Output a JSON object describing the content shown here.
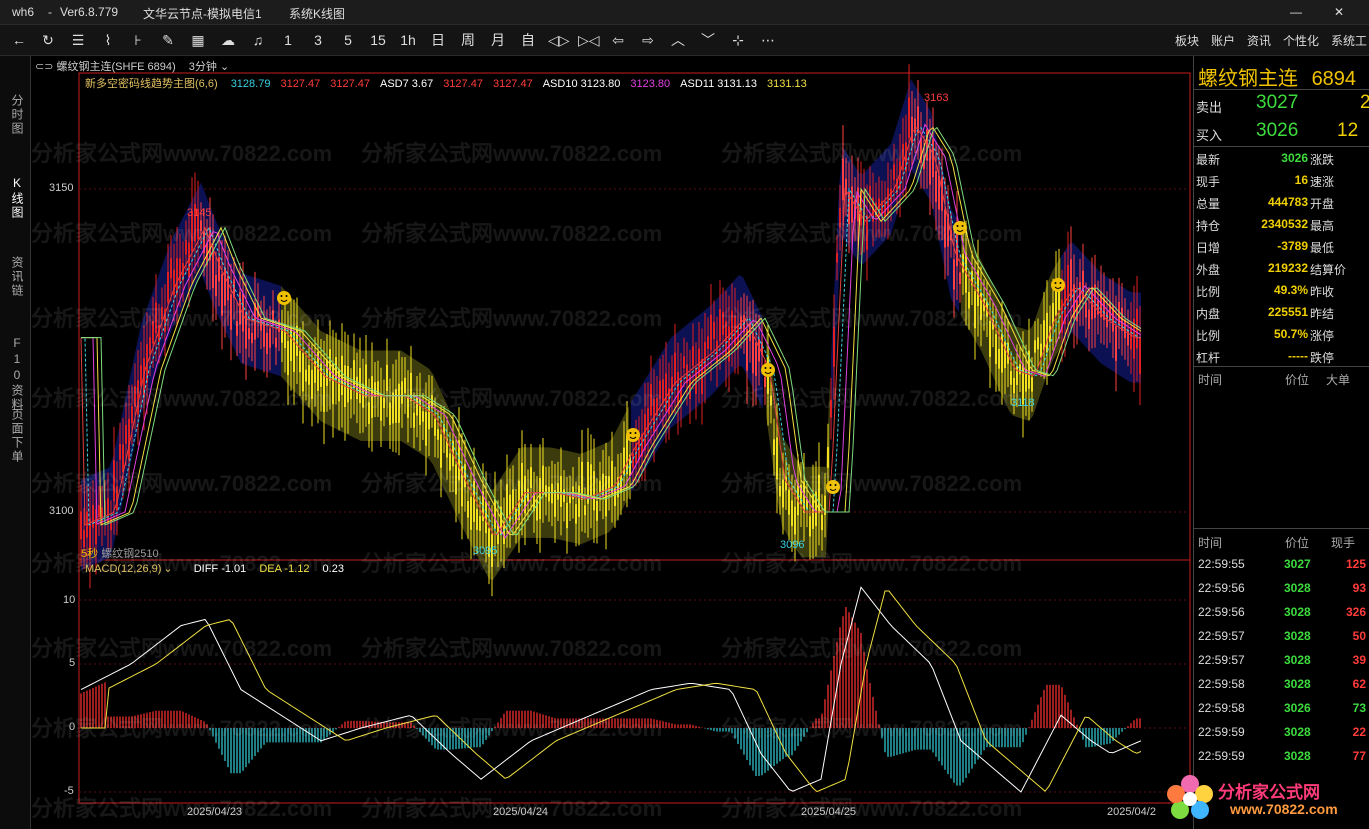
{
  "titlebar": {
    "app": "wh6",
    "sep": "-",
    "version": "Ver6.8.779",
    "server": "文华云节点-模拟电信1",
    "view": "系统K线图"
  },
  "toolbar": {
    "periods": [
      "1",
      "3",
      "5",
      "15",
      "1h",
      "日",
      "周",
      "月",
      "自"
    ],
    "menu": [
      "板块",
      "账户",
      "资讯",
      "个性化",
      "系统工"
    ]
  },
  "leftnav": {
    "tabs": [
      "分时图",
      "K线图",
      "资讯链",
      "F10资料",
      "页面下单"
    ]
  },
  "chart": {
    "contract": "螺纹钢主连(SHFE 6894)",
    "period": "3分钟",
    "indicator_main": "新多空密码线趋势主图(6,6)",
    "legend_values": [
      {
        "text": "3128.79",
        "color": "#39d0e0"
      },
      {
        "text": "3127.47",
        "color": "#ff3b3b"
      },
      {
        "text": "3127.47",
        "color": "#ff3b3b"
      },
      {
        "text": "ASD7 3.67",
        "color": "#ffffff"
      },
      {
        "text": "3127.47",
        "color": "#ff3b3b"
      },
      {
        "text": "3127.47",
        "color": "#ff3b3b"
      },
      {
        "text": "ASD10 3123.80",
        "color": "#ffffff"
      },
      {
        "text": "3123.80",
        "color": "#e040e0"
      },
      {
        "text": "ASD11 3131.13",
        "color": "#ffffff"
      },
      {
        "text": "3131.13",
        "color": "#f0e040"
      }
    ],
    "y_labels": [
      "3150",
      "3100"
    ],
    "peak_labels": [
      "3145",
      "3095",
      "3096",
      "3163",
      "3118"
    ],
    "watermark": "分析家公式网www.70822.com",
    "sub_label": "螺纹钢2510",
    "sub_prefix": "5秒",
    "macd": {
      "label": "MACD(12,26,9)",
      "diff": "DIFF -1.01",
      "dea": "DEA -1.12",
      "macd": "0.23",
      "y_labels": [
        "10",
        "5",
        "0",
        "-5"
      ]
    },
    "dates": [
      "2025/04/23",
      "2025/04/24",
      "2025/04/25",
      "2025/04/2"
    ]
  },
  "quote": {
    "name": "螺纹钢主连",
    "code": "6894",
    "sell_label": "卖出",
    "sell_price": "3027",
    "sell_vol": "2",
    "buy_label": "买入",
    "buy_price": "3026",
    "buy_vol": "12",
    "stats": [
      {
        "l": "最新",
        "v": "3026",
        "r": "涨跌",
        "color": "#3ddc3d"
      },
      {
        "l": "现手",
        "v": "16",
        "r": "速涨",
        "color": "#f0d000"
      },
      {
        "l": "总量",
        "v": "444783",
        "r": "开盘",
        "color": "#f0d000"
      },
      {
        "l": "持仓",
        "v": "2340532",
        "r": "最高",
        "color": "#f0d000"
      },
      {
        "l": "日增",
        "v": "-3789",
        "r": "最低",
        "color": "#f0d000"
      },
      {
        "l": "外盘",
        "v": "219232",
        "r": "结算价",
        "color": "#f0d000"
      },
      {
        "l": "比例",
        "v": "49.3%",
        "r": "昨收",
        "color": "#f0d000"
      },
      {
        "l": "内盘",
        "v": "225551",
        "r": "昨结",
        "color": "#f0d000"
      },
      {
        "l": "比例",
        "v": "50.7%",
        "r": "涨停",
        "color": "#f0d000"
      },
      {
        "l": "杠杆",
        "v": "-----",
        "r": "跌停",
        "color": "#f0d000"
      }
    ],
    "head1": [
      "时间",
      "价位",
      "大单"
    ],
    "head2": [
      "时间",
      "价位",
      "现手"
    ],
    "ticks": [
      {
        "t": "22:59:55",
        "p": "3027",
        "v": "125",
        "vc": "#ff3b3b"
      },
      {
        "t": "22:59:56",
        "p": "3028",
        "v": "93",
        "vc": "#ff3b3b"
      },
      {
        "t": "22:59:56",
        "p": "3028",
        "v": "326",
        "vc": "#ff3b3b"
      },
      {
        "t": "22:59:57",
        "p": "3028",
        "v": "50",
        "vc": "#ff3b3b"
      },
      {
        "t": "22:59:57",
        "p": "3028",
        "v": "39",
        "vc": "#ff3b3b"
      },
      {
        "t": "22:59:58",
        "p": "3028",
        "v": "62",
        "vc": "#ff3b3b"
      },
      {
        "t": "22:59:58",
        "p": "3026",
        "v": "73",
        "vc": "#3ddc3d"
      },
      {
        "t": "22:59:59",
        "p": "3028",
        "v": "22",
        "vc": "#ff3b3b"
      },
      {
        "t": "22:59:59",
        "p": "3028",
        "v": "77",
        "vc": "#ff3b3b"
      }
    ]
  },
  "logo": {
    "name": "分析家公式网",
    "url": "www.70822.com"
  }
}
